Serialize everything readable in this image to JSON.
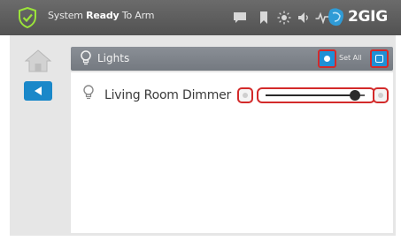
{
  "status_bar": {
    "status_prefix": "System ",
    "status_bold": "Ready",
    "status_suffix": " To Arm",
    "icons": [
      "shield-check-icon",
      "chat-icon",
      "bookmark-icon",
      "sun-icon",
      "speaker-icon",
      "activity-icon"
    ],
    "brand": "2GIG"
  },
  "nav": {
    "home_icon": "home-icon",
    "back_icon": "back-arrow-icon"
  },
  "header": {
    "icon": "lightbulb-icon",
    "title": "Lights",
    "set_all_label": "Set All"
  },
  "devices": [
    {
      "name": "Living Room Dimmer",
      "icon": "lightbulb-icon",
      "level": 0.9
    }
  ],
  "colors": {
    "accent_blue": "#1a88c9",
    "highlight_red": "#d32a2a",
    "status_bar": "#5c5c5c",
    "header_bar": "#7f848b"
  }
}
